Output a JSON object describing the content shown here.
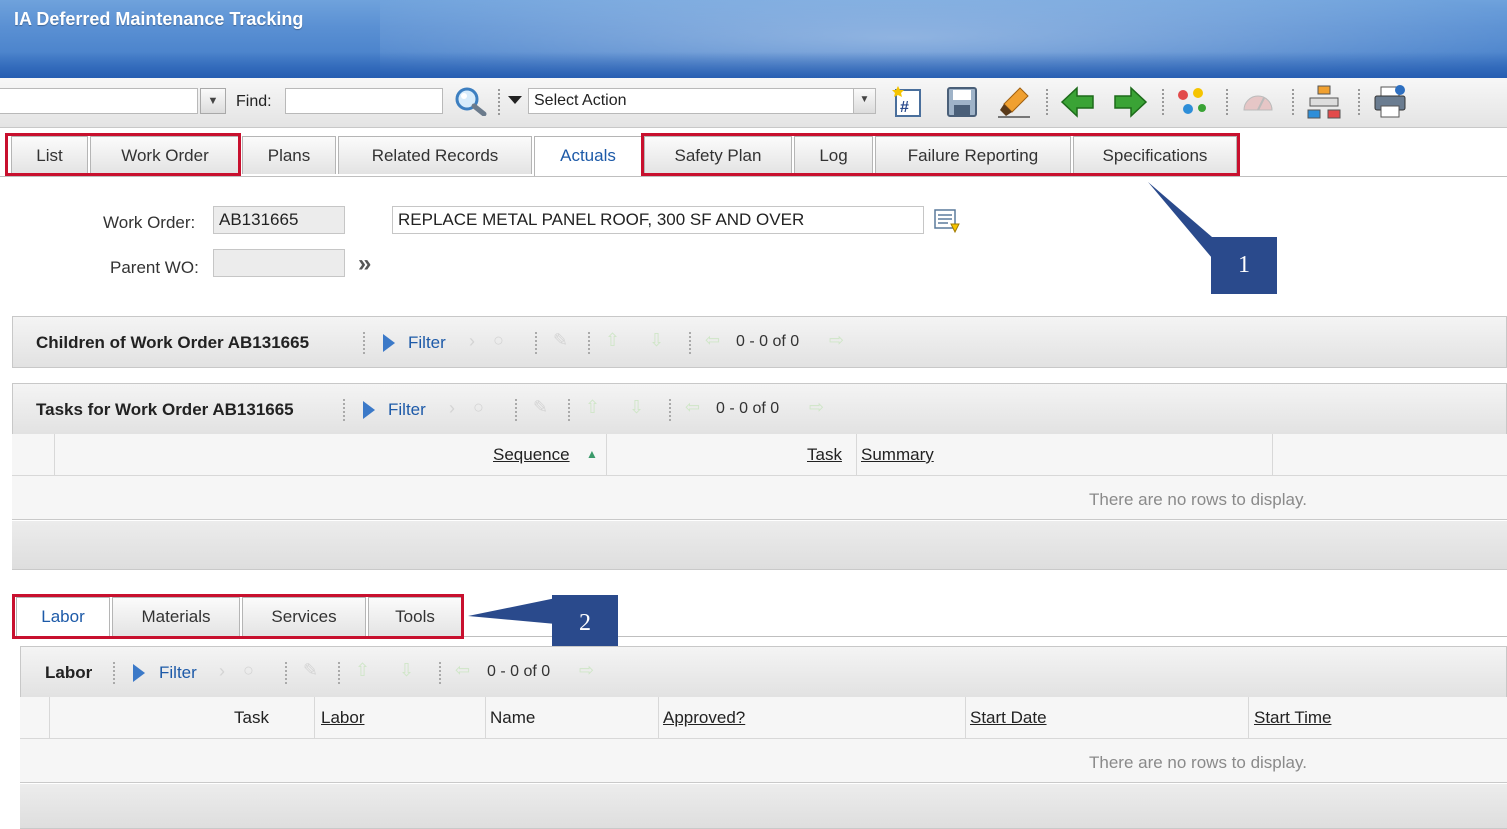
{
  "app": {
    "title": "IA Deferred Maintenance Tracking"
  },
  "toolbar": {
    "find_label": "Find:",
    "find_value": "",
    "select_action": "Select Action",
    "icons": [
      "dropdown-icon",
      "search-icon",
      "new-record-icon",
      "save-icon",
      "clear-changes-icon",
      "previous-record-icon",
      "next-record-icon",
      "workflow-icon",
      "gauge-icon",
      "hierarchy-icon",
      "print-icon"
    ]
  },
  "tabs": [
    {
      "label": "List"
    },
    {
      "label": "Work Order"
    },
    {
      "label": "Plans"
    },
    {
      "label": "Related Records"
    },
    {
      "label": "Actuals",
      "active": true
    },
    {
      "label": "Safety Plan"
    },
    {
      "label": "Log"
    },
    {
      "label": "Failure Reporting"
    },
    {
      "label": "Specifications"
    }
  ],
  "form": {
    "work_order_label": "Work Order:",
    "work_order_value": "AB131665",
    "description": "REPLACE METAL PANEL ROOF, 300 SF AND OVER",
    "parent_wo_label": "Parent WO:",
    "parent_wo_value": ""
  },
  "callouts": {
    "one": "1",
    "two": "2"
  },
  "children_section": {
    "title": "Children of Work Order AB131665",
    "filter": "Filter",
    "pager": "0 - 0 of 0"
  },
  "tasks_section": {
    "title": "Tasks for Work Order AB131665",
    "filter": "Filter",
    "pager": "0 - 0 of 0",
    "columns": [
      "Sequence",
      "Task",
      "Summary"
    ],
    "empty": "There are no rows to display."
  },
  "subtabs": [
    {
      "label": "Labor",
      "active": true
    },
    {
      "label": "Materials"
    },
    {
      "label": "Services"
    },
    {
      "label": "Tools"
    }
  ],
  "labor_section": {
    "title": "Labor",
    "filter": "Filter",
    "pager": "0 - 0 of 0",
    "columns": [
      "Task",
      "Labor",
      "Name",
      "Approved?",
      "Start Date",
      "Start Time"
    ],
    "empty": "There are no rows to display."
  },
  "colors": {
    "accent": "#1d5aa8",
    "highlight": "#c8102e",
    "callout": "#2a4a8c"
  }
}
